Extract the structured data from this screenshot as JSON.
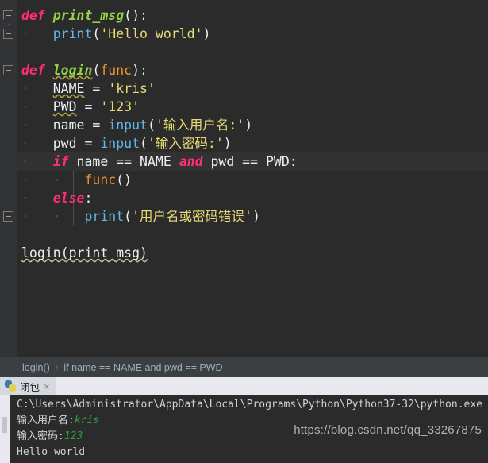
{
  "editor": {
    "lines": [
      {
        "indent": 0,
        "fold": "open",
        "tokens": [
          {
            "t": "def",
            "c": "kw"
          },
          {
            "t": " ",
            "c": "pl"
          },
          {
            "t": "print_msg",
            "c": "fn"
          },
          {
            "t": "():",
            "c": "punc"
          }
        ]
      },
      {
        "indent": 1,
        "fold": "end",
        "tokens": [
          {
            "t": "print",
            "c": "bfn"
          },
          {
            "t": "(",
            "c": "punc"
          },
          {
            "t": "'Hello world'",
            "c": "str"
          },
          {
            "t": ")",
            "c": "punc"
          }
        ]
      },
      {
        "indent": 0,
        "fold": null,
        "tokens": []
      },
      {
        "indent": 0,
        "fold": "open",
        "tokens": [
          {
            "t": "def",
            "c": "kw"
          },
          {
            "t": " ",
            "c": "pl"
          },
          {
            "t": "login",
            "c": "fn wavy"
          },
          {
            "t": "(",
            "c": "punc"
          },
          {
            "t": "func",
            "c": "par"
          },
          {
            "t": "):",
            "c": "punc"
          }
        ]
      },
      {
        "indent": 1,
        "fold": null,
        "tokens": [
          {
            "t": "NAME",
            "c": "pl wavy"
          },
          {
            "t": " = ",
            "c": "punc"
          },
          {
            "t": "'kris'",
            "c": "str"
          }
        ]
      },
      {
        "indent": 1,
        "fold": null,
        "tokens": [
          {
            "t": "PWD",
            "c": "pl wavy"
          },
          {
            "t": " = ",
            "c": "punc"
          },
          {
            "t": "'123'",
            "c": "str"
          }
        ]
      },
      {
        "indent": 1,
        "fold": null,
        "tokens": [
          {
            "t": "name",
            "c": "pl"
          },
          {
            "t": " = ",
            "c": "punc"
          },
          {
            "t": "input",
            "c": "bfn"
          },
          {
            "t": "(",
            "c": "punc"
          },
          {
            "t": "'输入用户名:'",
            "c": "str"
          },
          {
            "t": ")",
            "c": "punc"
          }
        ]
      },
      {
        "indent": 1,
        "fold": null,
        "tokens": [
          {
            "t": "pwd",
            "c": "pl"
          },
          {
            "t": " = ",
            "c": "punc"
          },
          {
            "t": "input",
            "c": "bfn"
          },
          {
            "t": "(",
            "c": "punc"
          },
          {
            "t": "'输入密码:'",
            "c": "str"
          },
          {
            "t": ")",
            "c": "punc"
          }
        ]
      },
      {
        "indent": 1,
        "fold": null,
        "highlight": true,
        "tokens": [
          {
            "t": "if",
            "c": "kw"
          },
          {
            "t": " name == NAME ",
            "c": "pl"
          },
          {
            "t": "and",
            "c": "kw"
          },
          {
            "t": " pwd == PWD:",
            "c": "pl"
          }
        ]
      },
      {
        "indent": 2,
        "fold": null,
        "tokens": [
          {
            "t": "func",
            "c": "par"
          },
          {
            "t": "()",
            "c": "punc"
          }
        ]
      },
      {
        "indent": 1,
        "fold": null,
        "tokens": [
          {
            "t": "else",
            "c": "kw"
          },
          {
            "t": ":",
            "c": "punc"
          }
        ]
      },
      {
        "indent": 2,
        "fold": "end",
        "tokens": [
          {
            "t": "print",
            "c": "bfn"
          },
          {
            "t": "(",
            "c": "punc"
          },
          {
            "t": "'用户名或密码错误'",
            "c": "str"
          },
          {
            "t": ")",
            "c": "punc"
          }
        ]
      },
      {
        "indent": 0,
        "fold": null,
        "tokens": []
      },
      {
        "indent": 0,
        "fold": null,
        "tokens": [
          {
            "t": "login(print_msg)",
            "c": "pl wavy-w"
          }
        ]
      }
    ]
  },
  "breadcrumb": {
    "items": [
      "login()",
      "if name == NAME and pwd == PWD"
    ],
    "separator": "›"
  },
  "run_panel": {
    "tab": {
      "label": "闭包",
      "icon": "python-icon",
      "close": "×"
    },
    "console": {
      "lines": [
        {
          "parts": [
            {
              "text": "C:\\Users\\Administrator\\AppData\\Local\\Programs\\Python\\Python37-32\\python.exe",
              "kind": "out"
            }
          ]
        },
        {
          "parts": [
            {
              "text": "输入用户名:",
              "kind": "out"
            },
            {
              "text": "kris",
              "kind": "in"
            }
          ]
        },
        {
          "parts": [
            {
              "text": "输入密码:",
              "kind": "out"
            },
            {
              "text": "123",
              "kind": "in"
            }
          ]
        },
        {
          "parts": [
            {
              "text": "Hello world",
              "kind": "out"
            }
          ]
        }
      ]
    }
  },
  "watermark": "https://blog.csdn.net/qq_33267875",
  "colors": {
    "editor_bg": "#2b2b2b",
    "gutter_bg": "#313335",
    "highlight_line": "#323232",
    "keyword": "#ff2d72",
    "function": "#95d346",
    "builtin": "#62b7ea",
    "string": "#e6db74",
    "param": "#f0912d",
    "plain": "#eceff1",
    "console_in": "#2e9e3f",
    "breadcrumb_bg": "#3c3f41"
  }
}
